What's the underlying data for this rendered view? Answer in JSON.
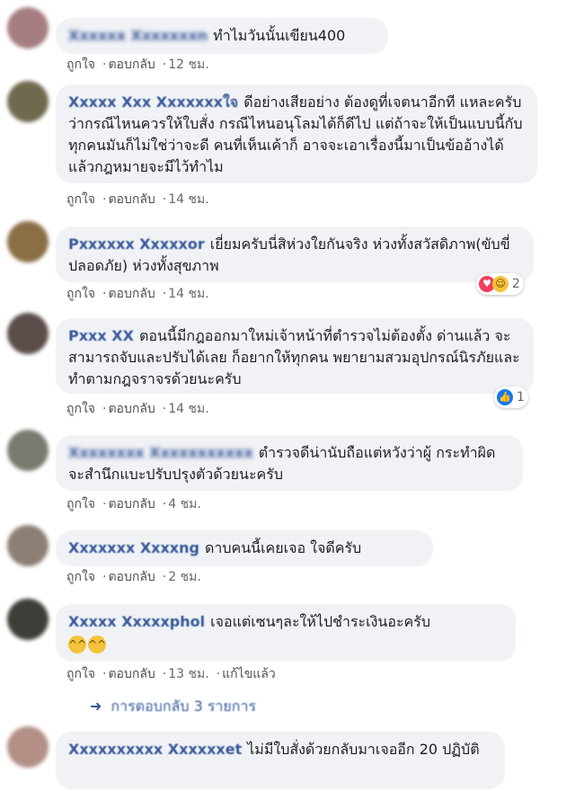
{
  "actions": {
    "like": "ถูกใจ",
    "reply": "ตอบกลับ",
    "edited": "แก้ไขแล้ว"
  },
  "comments": [
    {
      "name": "Xxxxxx Xxxxxxxn",
      "text": "ทำไมวันนั้นเขียน400",
      "time": "12 ชม."
    },
    {
      "name": "Xxxxx Xxx Xxxxxxxใจ",
      "text": "ดีอย่างเสียอย่าง ต้องดูที่เจตนาอีกที แหละครับ ว่ากรณีไหนควรให้ใบสั่ง กรณีไหนอนุโลมได้ก็ดีไป แต่ถ้าจะให้เป็นแบบนี้กับทุกคนมันก็ไม่ใช่ว่าจะดี คนที่เห็นเค้าก็ อาจจะเอาเรื่องนี้มาเป็นข้ออ้างได้ แล้วกฎหมายจะมีไว้ทำไม",
      "time": "14 ชม."
    },
    {
      "name": "Pxxxxxx Xxxxxor",
      "text": "เยี่ยมครับนี่สิห่วงใยกันจริง ห่วงทั้งสวัสดิภาพ(ขับขี่ปลอดภัย) ห่วงทั้งสุขภาพ",
      "time": "14 ชม.",
      "reaction_count": "2"
    },
    {
      "name": "Pxxx XX",
      "text": "ตอนนี้มีกฎออกมาใหม่เจ้าหน้าที่ตำรวจไม่ต้องตั้ง ด่านแล้ว จะสามารถจับและปรับได้เลย ก็อยากให้ทุกคน พยายามสวมอุปกรณ์นิรภัยและทำตามกฎจราจรด้วยนะครับ",
      "time": "14 ชม.",
      "reaction_count": "1"
    },
    {
      "name": "Xxxxxxxx Xxxxxxxxxxx",
      "text": "ตำรวจดีน่านับถือแต่หวังว่าผู้ กระทำผิดจะสำนึกแบะปรับปรุงตัวด้วยนะครับ",
      "time": "4 ชม."
    },
    {
      "name": "Xxxxxxx Xxxxng",
      "text": "ดาบคนนี้เคยเจอ ใจดีครับ",
      "time": "2 ชม."
    },
    {
      "name": "Xxxxx Xxxxxphol",
      "text": "เจอแต่เซนๆละให้ไปชำระเงินอะครับ",
      "emoji": "😆😆",
      "time": "13 ชม."
    },
    {
      "name": "Xxxxxxxxxx Xxxxxxet",
      "text": "ไม่มีใบสั่งด้วยกลับมาเจออีก 20 ปฏิบัติ"
    }
  ],
  "replies_label": "การตอบกลับ 3 รายการ",
  "colors": {
    "name": "#365899",
    "bubble": "#f0f2f5",
    "meta": "#65676b",
    "like_blue": "#1877f2",
    "love_red": "#f33e58"
  },
  "icons": {
    "love": "heart-icon",
    "haha": "haha-emoji-icon",
    "like": "thumbs-up-icon",
    "reply_arrow": "reply-arrow-icon"
  }
}
